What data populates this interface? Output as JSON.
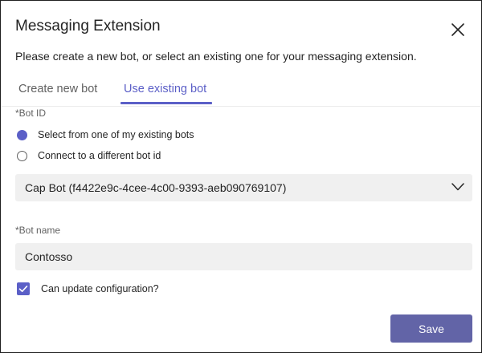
{
  "dialog": {
    "title": "Messaging Extension",
    "description": "Please create a new bot, or select an existing one for your messaging extension."
  },
  "tabs": [
    {
      "label": "Create new bot",
      "active": false
    },
    {
      "label": "Use existing bot",
      "active": true
    }
  ],
  "bot_id": {
    "label": "*Bot ID",
    "options": [
      {
        "label": "Select from one of my existing bots",
        "checked": true
      },
      {
        "label": "Connect to a different bot id",
        "checked": false
      }
    ],
    "selected_bot": "Cap Bot (f4422e9c-4cee-4c00-9393-aeb090769107)"
  },
  "bot_name": {
    "label": "*Bot name",
    "value": "Contosso"
  },
  "update_configuration": {
    "label": "Can update configuration?",
    "checked": true
  },
  "actions": {
    "save_label": "Save"
  },
  "icons": {
    "close": "close-icon",
    "dropdown": "chevron-down-icon",
    "checkbox": "checkmark-icon"
  },
  "colors": {
    "accent": "#5b5fc7",
    "button": "#6264a7",
    "field_background": "#f0f0f0"
  }
}
